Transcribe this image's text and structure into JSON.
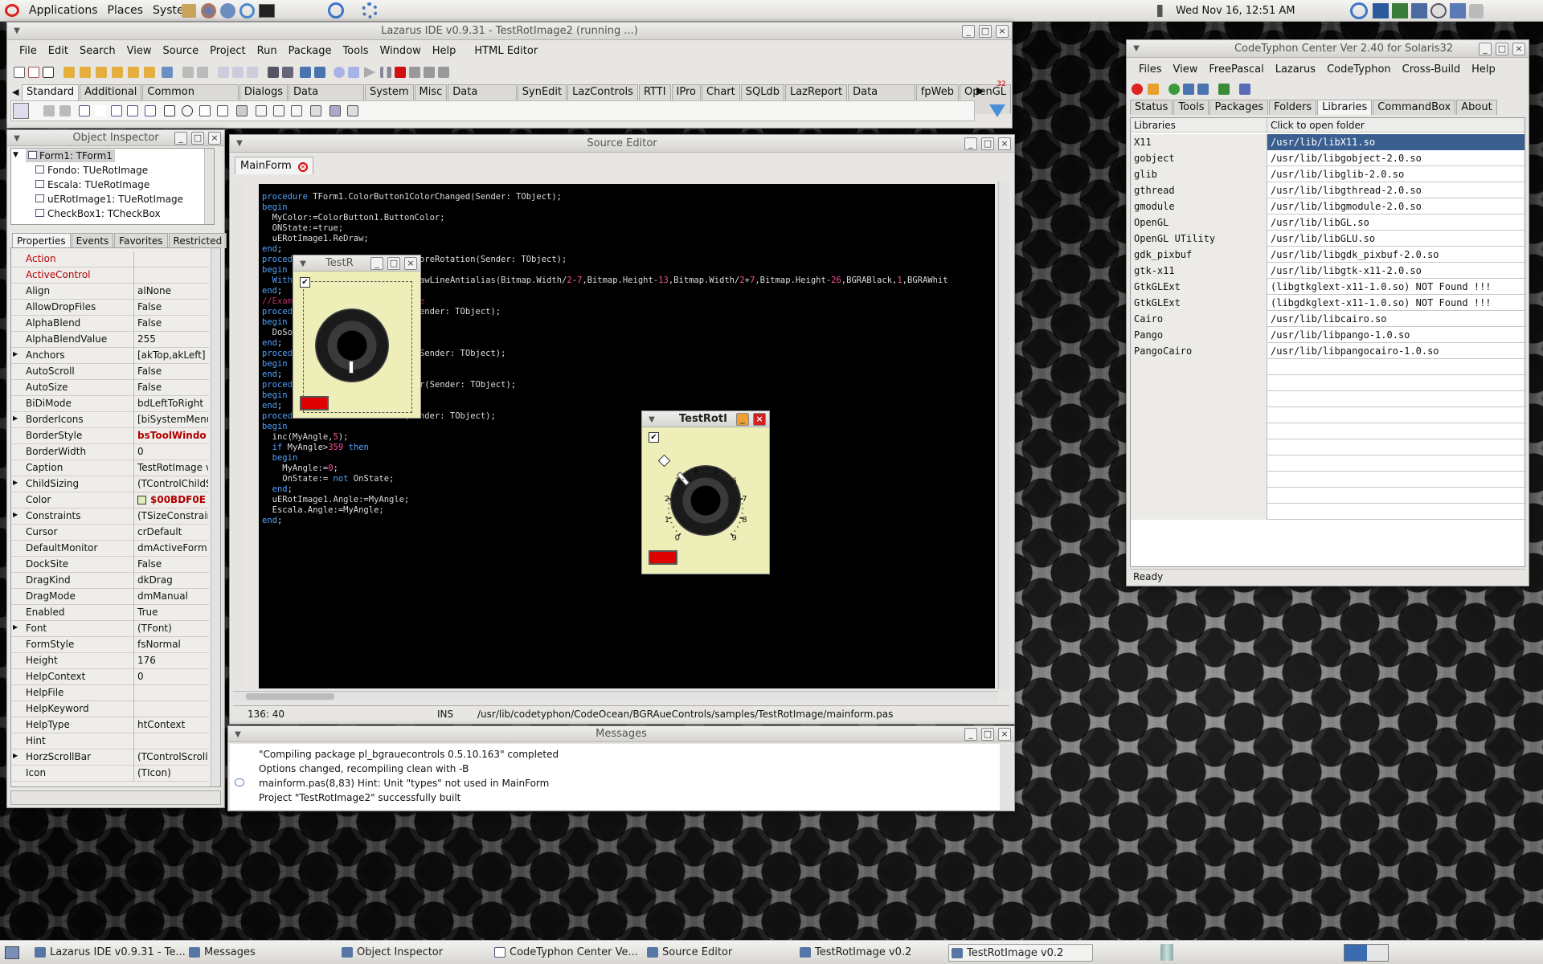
{
  "top_panel": {
    "menus": [
      "Applications",
      "Places",
      "System"
    ],
    "clock": "Wed Nov 16, 12:51 AM"
  },
  "lazarus": {
    "title": "Lazarus IDE v0.9.31 - TestRotImage2 (running ...)",
    "menu": [
      "File",
      "Edit",
      "Search",
      "View",
      "Source",
      "Project",
      "Run",
      "Package",
      "Tools",
      "Window",
      "Help",
      "HTML Editor"
    ],
    "palette_tabs": [
      "Standard",
      "Additional",
      "Common Controls",
      "Dialogs",
      "Data Controls",
      "System",
      "Misc",
      "Data Access",
      "SynEdit",
      "LazControls",
      "RTTI",
      "IPro",
      "Chart",
      "SQLdb",
      "LazReport",
      "Data Export",
      "fpWeb",
      "OpenGL"
    ],
    "palette_counter": "32"
  },
  "object_inspector": {
    "title": "Object Inspector",
    "tree": [
      "Form1: TForm1",
      "Fondo: TUeRotImage",
      "Escala: TUeRotImage",
      "uERotImage1: TUeRotImage",
      "CheckBox1: TCheckBox"
    ],
    "tabs": [
      "Properties",
      "Events",
      "Favorites",
      "Restricted"
    ],
    "props": [
      [
        "Action",
        ""
      ],
      [
        "ActiveControl",
        ""
      ],
      [
        "Align",
        "alNone"
      ],
      [
        "AllowDropFiles",
        "False"
      ],
      [
        "AlphaBlend",
        "False"
      ],
      [
        "AlphaBlendValue",
        "255"
      ],
      [
        "Anchors",
        "[akTop,akLeft]"
      ],
      [
        "AutoScroll",
        "False"
      ],
      [
        "AutoSize",
        "False"
      ],
      [
        "BiDiMode",
        "bdLeftToRight"
      ],
      [
        "BorderIcons",
        "[biSystemMenu"
      ],
      [
        "BorderStyle",
        "bsToolWindo"
      ],
      [
        "BorderWidth",
        "0"
      ],
      [
        "Caption",
        "TestRotImage v"
      ],
      [
        "ChildSizing",
        "(TControlChildS"
      ],
      [
        "Color",
        "$00BDF0E"
      ],
      [
        "Constraints",
        "(TSizeConstrair"
      ],
      [
        "Cursor",
        "crDefault"
      ],
      [
        "DefaultMonitor",
        "dmActiveForm"
      ],
      [
        "DockSite",
        "False"
      ],
      [
        "DragKind",
        "dkDrag"
      ],
      [
        "DragMode",
        "dmManual"
      ],
      [
        "Enabled",
        "True"
      ],
      [
        "Font",
        "(TFont)"
      ],
      [
        "FormStyle",
        "fsNormal"
      ],
      [
        "Height",
        "176"
      ],
      [
        "HelpContext",
        "0"
      ],
      [
        "HelpFile",
        ""
      ],
      [
        "HelpKeyword",
        ""
      ],
      [
        "HelpType",
        "htContext"
      ],
      [
        "Hint",
        ""
      ],
      [
        "HorzScrollBar",
        "(TControlScrollE"
      ],
      [
        "Icon",
        "(TIcon)"
      ]
    ]
  },
  "source_editor": {
    "title": "Source Editor",
    "tab": "MainForm",
    "status_pos": "136: 40",
    "status_mode": "INS",
    "status_file": "/usr/lib/codetyphon/CodeOcean/BGRAueControls/samples/TestRotImage/mainform.pas",
    "lines": [
      "procedure TForm1.ColorButton1ColorChanged(Sender: TObject);",
      "begin",
      "  MyColor:=ColorButton1.ButtonColor;",
      "  ONState:=true;",
      "  uERotImage1.ReDraw;",
      "end;",
      "",
      "procedure TForm1.uERotImage1BeforeRotation(Sender: TObject);",
      "begin",
      "  With uERotImage1.Bitmap do DrawLineAntialias(Bitmap.Width/2-7,Bitmap.Height-13,Bitmap.Width/2+7,Bitmap.Height-26,BGRABlack,1,BGRAWhit",
      "end;",
      "",
      "//Example: Draw a rotating state",
      "procedure TForm1.Button1Click(Sender: TObject);",
      "begin",
      "  DoSomething;",
      "end;",
      "",
      "procedure TForm1.FondoRotation(Sender: TObject);",
      "begin",
      "",
      "end;",
      "",
      "procedure TForm1.IdleTimer1Timer(Sender: TObject);",
      "begin",
      "end;",
      "",
      "procedure TForm1.Timer1Timer(Sender: TObject);",
      "begin",
      "  inc(MyAngle,5);",
      "  if MyAngle>359 then",
      "  begin",
      "    MyAngle:=0;",
      "    OnState:= not OnState;",
      "  end;",
      "  uERotImage1.Angle:=MyAngle;",
      "  Escala.Angle:=MyAngle;",
      "end;"
    ]
  },
  "messages": {
    "title": "Messages",
    "lines": [
      "\"Compiling package pl_bgrauecontrols 0.5.10.163\" completed",
      "Options changed, recompiling clean with -B",
      "mainform.pas(8,83) Hint: Unit \"types\" not used in MainForm",
      "Project \"TestRotImage2\" successfully built"
    ]
  },
  "test_small": {
    "title": "TestR"
  },
  "test_big": {
    "title": "TestRotI",
    "dial_labels": [
      "0",
      "1",
      "2",
      "3",
      "4",
      "5",
      "6",
      "7",
      "8",
      "9"
    ]
  },
  "codetyphon": {
    "title": "CodeTyphon Center Ver 2.40 for Solaris32",
    "menu": [
      "Files",
      "View",
      "FreePascal",
      "Lazarus",
      "CodeTyphon",
      "Cross-Build",
      "Help"
    ],
    "tabs": [
      "Status",
      "Tools",
      "Packages",
      "Folders",
      "Libraries",
      "CommandBox",
      "About"
    ],
    "col1": "Libraries",
    "col2": "Click to open folder",
    "libs": [
      [
        "X11",
        "/usr/lib/libX11.so"
      ],
      [
        "gobject",
        "/usr/lib/libgobject-2.0.so"
      ],
      [
        "glib",
        "/usr/lib/libglib-2.0.so"
      ],
      [
        "gthread",
        "/usr/lib/libgthread-2.0.so"
      ],
      [
        "gmodule",
        "/usr/lib/libgmodule-2.0.so"
      ],
      [
        "OpenGL",
        "/usr/lib/libGL.so"
      ],
      [
        "OpenGL UTility",
        "/usr/lib/libGLU.so"
      ],
      [
        "gdk_pixbuf",
        "/usr/lib/libgdk_pixbuf-2.0.so"
      ],
      [
        "gtk-x11",
        "/usr/lib/libgtk-x11-2.0.so"
      ],
      [
        "GtkGLExt",
        "(libgtkglext-x11-1.0.so) NOT Found !!!"
      ],
      [
        "GtkGLExt",
        "(libgdkglext-x11-1.0.so) NOT Found !!!"
      ],
      [
        "Cairo",
        "/usr/lib/libcairo.so"
      ],
      [
        "Pango",
        "/usr/lib/libpango-1.0.so"
      ],
      [
        "PangoCairo",
        "/usr/lib/libpangocairo-1.0.so"
      ]
    ],
    "status": "Ready"
  },
  "taskbar": [
    "Lazarus IDE v0.9.31 - Te...",
    "Messages",
    "Object Inspector",
    "CodeTyphon Center Ve...",
    "Source Editor",
    "TestRotImage v0.2",
    "TestRotImage v0.2"
  ]
}
